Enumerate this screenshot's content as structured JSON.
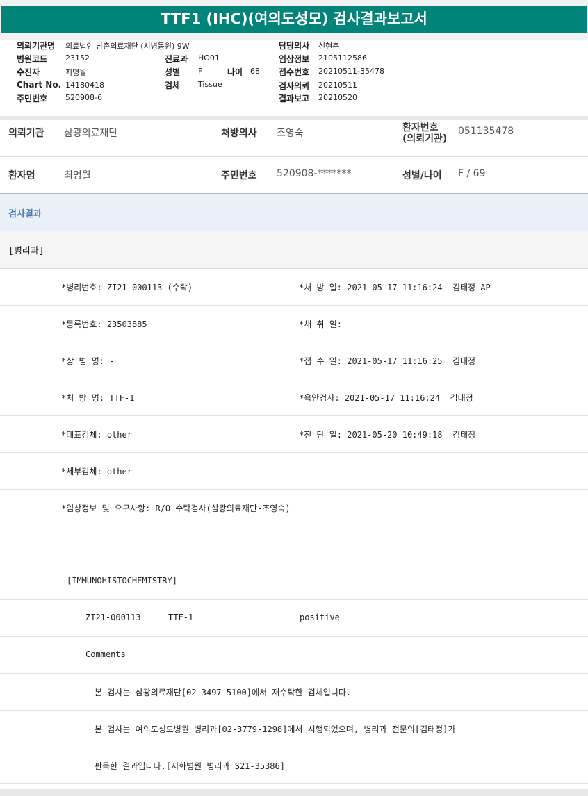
{
  "report_title": "TTF1 (IHC)(여의도성모) 검사결과보고서",
  "header": {
    "left": [
      {
        "label": "의뢰기관명",
        "value": "의료법인 남촌의료재단 (시병동원) 9W"
      },
      {
        "label": "병원코드",
        "value": "23152"
      },
      {
        "label": "수진자",
        "value": "최명월"
      },
      {
        "label": "Chart No.",
        "value": "14180418"
      },
      {
        "label": "주민번호",
        "value": "520908-6"
      }
    ],
    "mid": [
      {
        "label": "진료과",
        "value": "HO01"
      },
      {
        "label": "성별",
        "value": "F"
      },
      {
        "label": "검체",
        "value": "Tissue"
      }
    ],
    "age_label": "나이",
    "age_value": "68",
    "right": [
      {
        "label": "담당의사",
        "value": "신현춘"
      },
      {
        "label": "임상정보",
        "value": "2105112586"
      },
      {
        "label": "접수번호",
        "value": "20210511-35478"
      },
      {
        "label": "검사의뢰",
        "value": "20210511"
      },
      {
        "label": "결과보고",
        "value": "20210520"
      }
    ]
  },
  "info": {
    "institution_label": "의뢰기관",
    "institution_value": "삼광의료재단",
    "doctor_label": "처방의사",
    "doctor_value": "조영숙",
    "patient_no_label_1": "환자번호",
    "patient_no_label_2": "(의뢰기관)",
    "patient_no_value": "051135478",
    "patient_label": "환자명",
    "patient_value": "최명월",
    "rrn_label": "주민번호",
    "rrn_value": "520908-*******",
    "sex_age_label": "성별/나이",
    "sex_age_value": "F / 69"
  },
  "result_header": "검사결과",
  "section": "[병리과]",
  "rows": [
    {
      "left": "*병리번호: ZI21-000113 (수탁)",
      "right": "*처 방 일: 2021-05-17 11:16:24  김태정 AP"
    },
    {
      "left": "*등록번호: 23503885",
      "right": "*채 취 일:"
    },
    {
      "left": "*상 병 명: -",
      "right": "*접 수 일: 2021-05-17 11:16:25  김태정"
    },
    {
      "left": "*처 방 명: TTF-1",
      "right": "*육안검사: 2021-05-17 11:16:24  김태정"
    },
    {
      "left": "*대표검체: other",
      "right": "*진 단 일: 2021-05-20 10:49:18  김태정"
    },
    {
      "left": "*세부검체: other",
      "right": ""
    },
    {
      "left": "*임상정보 및 요구사항: R/O 수탁검사(삼광의료재단-조영숙)",
      "right": ""
    }
  ],
  "ihc_title": "[IMMUNOHISTOCHEMISTRY]",
  "ihc_result": {
    "case": "ZI21-000113",
    "marker": "TTF-1",
    "result": "positive"
  },
  "comments_label": "Comments",
  "comments": [
    "본 검사는 삼광의료재단[02-3497-5100]에서 재수탁한 검체입니다.",
    "본 검사는 여의도성모병원 병리과[02-3779-1298]에서 시행되었으며, 병리과 전문의[김태정]가",
    "판독한 결과입니다.[시화병원 병리과 S21-35386]"
  ]
}
